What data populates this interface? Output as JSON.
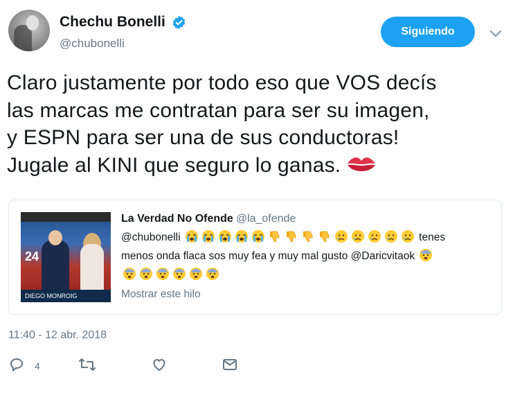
{
  "author": {
    "display_name": "Chechu Bonelli",
    "handle": "@chubonelli",
    "verified": true
  },
  "follow_button": {
    "label": "Siguiendo"
  },
  "tweet": {
    "lines": [
      "Claro justamente por todo eso que VOS decís",
      "las marcas me contratan para ser su imagen,",
      "y ESPN para ser una de sus conductoras!",
      "Jugale al KINI que seguro lo ganas."
    ],
    "trailing_emoji": "kiss-mark-icon"
  },
  "quoted_tweet": {
    "author_name": "La Verdad No Ofende",
    "author_handle": "@la_ofende",
    "mention": "@chubonelli",
    "text_after_emojis": "tenes",
    "line2": "menos onda flaca sos muy fea y muy mal gusto @Daricvitaok",
    "link_label": "Mostrar este hilo",
    "thumbnail": {
      "number": "24",
      "ticker": "DIEGO MONROIG"
    }
  },
  "timestamp": "11:40 - 12 abr. 2018",
  "actions": {
    "reply_count": "4"
  },
  "colors": {
    "accent": "#1da1f2",
    "secondary_text": "#657786",
    "text": "#14171a",
    "border": "#e1e8ed"
  }
}
